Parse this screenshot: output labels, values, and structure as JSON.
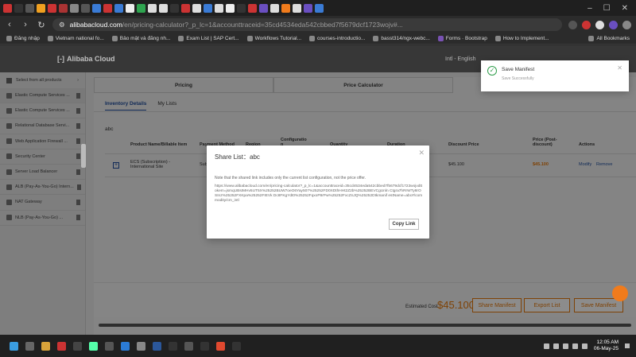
{
  "browser": {
    "url_host": "alibabacloud.com",
    "url_rest": "/en/pricing-calculator?_p_lc=1&accounttraceid=35cd4534eda542cbbed7f5679dcf1723wojv#...",
    "bookmarks": [
      "Đăng nhập",
      "Vietnam national fo...",
      "Bảo mật và đăng nh...",
      "Exam List | SAP Cert...",
      "Workflows Tutorial...",
      "courses-introductio...",
      "basst314/ngx-webc...",
      "Forms · Bootstrap",
      "How to Implement..."
    ],
    "all_bookmarks": "All Bookmarks"
  },
  "site": {
    "logo": "Alibaba Cloud",
    "region": "Intl - English"
  },
  "sidebar": {
    "header": "Select from all products",
    "items": [
      "Elastic Compute Services ...",
      "Elastic Compute Services ...",
      "Relational Database Servi...",
      "Web Application Firewall ...",
      "Security Center",
      "Server Load Balancer",
      "ALB (Pay-As-You-Go) Intern...",
      "NAT Gateway",
      "NLB (Pay-As-You-Go) ..."
    ]
  },
  "main": {
    "tabs": [
      "Pricing",
      "Price Calculator"
    ],
    "subtabs": [
      "Inventory Details",
      "My Lists"
    ],
    "list_name": "abc",
    "columns": [
      "Product Name/Billable Item",
      "Payment Method",
      "Region",
      "Configuratio n",
      "Quantity",
      "Duration",
      "Discount Price",
      "Price (Post-discount)",
      "Actions"
    ],
    "row": {
      "product": "ECS (Subscription) - International Site",
      "payment": "Sub",
      "discount_price": "$45.100",
      "post_price": "$45.100",
      "modify": "Modify",
      "remove": "Remove"
    },
    "estimated_label": "Estimated Cost",
    "estimated_value": "$45.100",
    "buttons": [
      "Share Manifest",
      "Export List",
      "Save Manifest"
    ]
  },
  "modal": {
    "title": "Share List：abc",
    "note": "Note that the shared link includes only the current list configuration, not the price offer.",
    "link": "https://www.alibabacloud.com/en/pricing-calculator?_p_lc=1&accounttraceid=35cd4534eda542cbbed7f5679dcf1723wojvdttokem=jsmqUBsIMHv5UT5X%25252BUW7oeO6Yay507%25252FD0XDthHHt2Z2b%25252BEVCgUnln Ctgra7hRrWTy8rOSInz%25252FXKpa%25252FIEVk Dc8FKgYdt0%25252FqxoP8rPw%25252FxcZnJQ%25252Dtkmanif estName=abc#/commodity/cm_intl",
    "copy": "Copy Link"
  },
  "toast": {
    "title": "Save Manifest",
    "sub": "Save Successfully"
  },
  "taskbar": {
    "time": "12:05 AM",
    "date": "06-May-25"
  }
}
